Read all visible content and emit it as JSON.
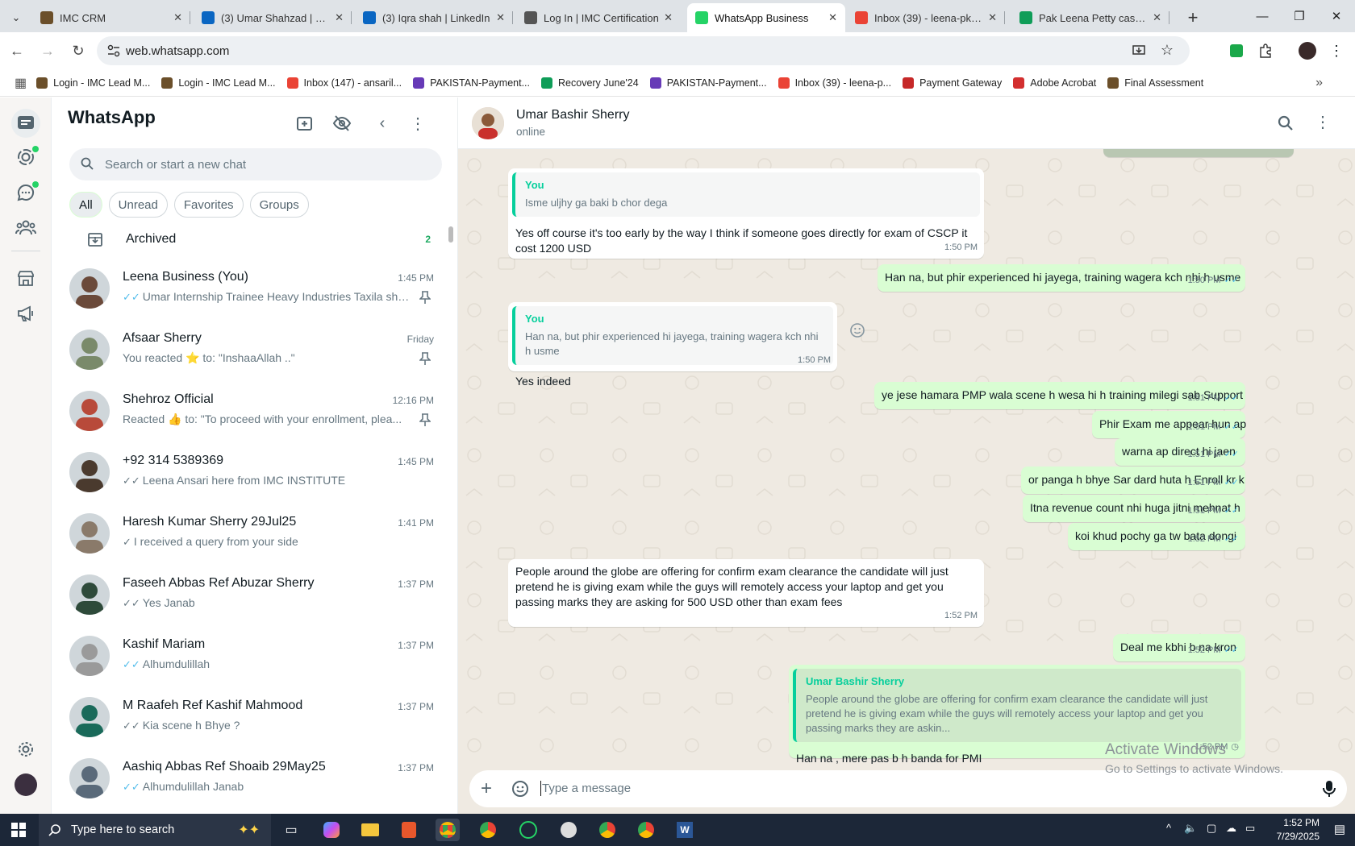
{
  "browser": {
    "tabs": [
      {
        "title": "IMC CRM",
        "color": "#6b4f2a"
      },
      {
        "title": "(3) Umar Shahzad | LinkedIn",
        "color": "#0a66c2"
      },
      {
        "title": "(3) Iqra shah | LinkedIn",
        "color": "#0a66c2"
      },
      {
        "title": "Log In | IMC Certification",
        "color": "#555555"
      },
      {
        "title": "WhatsApp Business",
        "color": "#25d366"
      },
      {
        "title": "Inbox (39) - leena-pk@imc",
        "color": "#ea4335"
      },
      {
        "title": "Pak Leena Petty cash - Go",
        "color": "#0f9d58"
      }
    ],
    "url": "web.whatsapp.com",
    "bookmarks": [
      {
        "label": "Login - IMC Lead M...",
        "color": "#6b4f2a"
      },
      {
        "label": "Login - IMC Lead M...",
        "color": "#6b4f2a"
      },
      {
        "label": "Inbox (147) - ansaril...",
        "color": "#ea4335"
      },
      {
        "label": "PAKISTAN-Payment...",
        "color": "#673ab7"
      },
      {
        "label": "Recovery June'24",
        "color": "#0f9d58"
      },
      {
        "label": "PAKISTAN-Payment...",
        "color": "#673ab7"
      },
      {
        "label": "Inbox (39) - leena-p...",
        "color": "#ea4335"
      },
      {
        "label": "Payment Gateway",
        "color": "#c62828"
      },
      {
        "label": "Adobe Acrobat",
        "color": "#d32f2f"
      },
      {
        "label": "Final Assessment",
        "color": "#6b4f2a"
      }
    ]
  },
  "sidebar": {
    "title": "WhatsApp",
    "search_placeholder": "Search or start a new chat",
    "filters": [
      "All",
      "Unread",
      "Favorites",
      "Groups"
    ],
    "archived_label": "Archived",
    "archived_count": "2",
    "chats": [
      {
        "name": "Leena Business (You)",
        "time": "1:45 PM",
        "preview": "Umar Internship Trainee Heavy Industries Taxila shah...",
        "tick": "double-blue",
        "pinned": true,
        "avatar": "#6b4a3a"
      },
      {
        "name": "Afsaar Sherry",
        "time": "Friday",
        "preview": "You reacted ⭐ to: \"InshaaAllah ..\"",
        "tick": "none",
        "pinned": true,
        "avatar": "#7a8a6a"
      },
      {
        "name": "Shehroz Official",
        "time": "12:16 PM",
        "preview": "Reacted 👍 to: \"To proceed with your enrollment, plea...",
        "tick": "none",
        "pinned": true,
        "avatar": "#b84a3a"
      },
      {
        "name": "+92 314 5389369",
        "time": "1:45 PM",
        "preview": "Leena Ansari here from IMC INSTITUTE",
        "tick": "double-grey",
        "pinned": false,
        "avatar": "#4a3a2e"
      },
      {
        "name": "Haresh Kumar Sherry 29Jul25",
        "time": "1:41 PM",
        "preview": "I received a query from your side",
        "tick": "single-grey",
        "pinned": false,
        "avatar": "#8a7a6a"
      },
      {
        "name": "Faseeh Abbas Ref Abuzar Sherry",
        "time": "1:37 PM",
        "preview": "Yes Janab",
        "tick": "double-grey",
        "pinned": false,
        "avatar": "#2e4a3a"
      },
      {
        "name": "Kashif Mariam",
        "time": "1:37 PM",
        "preview": "Alhumdulillah",
        "tick": "double-blue",
        "pinned": false,
        "avatar": "#9a9a9a"
      },
      {
        "name": "M Raafeh Ref Kashif Mahmood",
        "time": "1:37 PM",
        "preview": "Kia scene h Bhye ?",
        "tick": "double-grey",
        "pinned": false,
        "avatar": "#1a6a5a"
      },
      {
        "name": "Aashiq Abbas Ref Shoaib 29May25",
        "time": "1:37 PM",
        "preview": "Alhumdulillah Janab",
        "tick": "double-blue",
        "pinned": false,
        "avatar": "#5a6a7a"
      }
    ]
  },
  "conversation": {
    "contact_name": "Umar Bashir Sherry",
    "status": "online",
    "messages": [
      {
        "dir": "in",
        "quote_author": "You",
        "quote_text": "Isme uljhy ga baki b chor dega",
        "text": "Yes off course it's too early by the way I think if someone goes directly for exam of CSCP it cost 1200 USD",
        "time": "1:50 PM"
      },
      {
        "dir": "out",
        "text": "Han na, but phir experienced hi jayega, training wagera kch nhi h usme",
        "time": "1:50 PM"
      },
      {
        "dir": "in",
        "quote_author": "You",
        "quote_text": "Han na, but phir experienced hi jayega, training wagera kch nhi h usme",
        "text": "Yes indeed",
        "time": "1:50 PM"
      },
      {
        "dir": "out",
        "text": "ye jese hamara PMP wala scene h wesa hi h training milegi sab Support",
        "time": "1:51 PM"
      },
      {
        "dir": "out",
        "text": "Phir Exam me appear hun ap",
        "time": "1:51 PM"
      },
      {
        "dir": "out",
        "text": "warna ap direct hi jaen",
        "time": "1:51 PM"
      },
      {
        "dir": "out",
        "text": "or panga h bhye Sar dard huta h Enroll kr k",
        "time": "1:51 PM"
      },
      {
        "dir": "out",
        "text": "Itna revenue count nhi huga jitni mehnat h",
        "time": "1:51 PM"
      },
      {
        "dir": "out",
        "text": "koi khud pochy ga tw bata dongi",
        "time": "1:52 PM"
      },
      {
        "dir": "in",
        "text": "People around the globe are offering for confirm exam clearance the candidate will just pretend he is giving exam while the guys will remotely access your laptop and get you passing marks they are asking for 500 USD other than exam fees",
        "time": "1:52 PM"
      },
      {
        "dir": "out",
        "text": "Deal me kbhi b na kron",
        "time": "1:52 PM"
      },
      {
        "dir": "out",
        "quote_author": "Umar Bashir Sherry",
        "quote_text": "People around the globe are offering for confirm exam clearance the candidate will just pretend he is giving exam while the guys will remotely access your laptop and get you passing marks they are askin...",
        "text": "Han na , mere pas b h banda for PMI",
        "time": "1:52 PM",
        "pending": true
      }
    ],
    "compose_placeholder": "Type a message"
  },
  "watermark": {
    "line1": "Activate Windows",
    "line2": "Go to Settings to activate Windows."
  },
  "taskbar": {
    "search_placeholder": "Type here to search",
    "time": "1:52 PM",
    "date": "7/29/2025"
  }
}
